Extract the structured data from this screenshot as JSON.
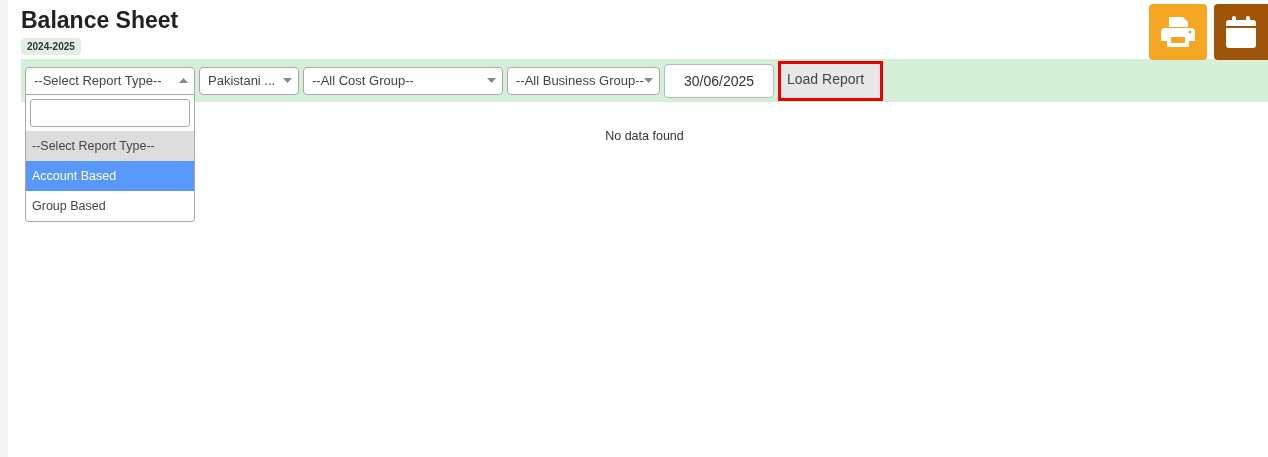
{
  "header": {
    "title": "Balance Sheet",
    "badge": "2024-2025"
  },
  "actions": [
    {
      "kind": "print"
    },
    {
      "kind": "calendar"
    }
  ],
  "filters": [
    {
      "kind": "select",
      "value": "--Select Report Type--",
      "open": true
    },
    {
      "kind": "select",
      "value": "Pakistani ...",
      "open": false
    },
    {
      "kind": "select",
      "value": "--All Cost Group--",
      "open": false
    },
    {
      "kind": "select",
      "value": "--All Business Group--",
      "open": false
    },
    {
      "kind": "date",
      "value": "30/06/2025"
    }
  ],
  "load_button": {
    "label": "Load Report",
    "outlined": true
  },
  "dropdown": {
    "options": [
      {
        "label": "--Select Report Type--",
        "selected": true,
        "highlighted": false
      },
      {
        "label": "Account Based",
        "selected": false,
        "highlighted": true
      },
      {
        "label": "Group Based",
        "selected": false,
        "highlighted": false
      }
    ]
  },
  "empty_message": "No data found"
}
